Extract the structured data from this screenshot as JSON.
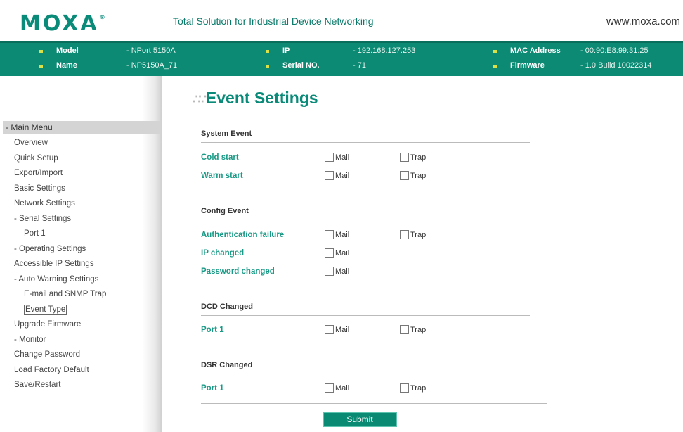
{
  "header": {
    "logo": "MOXA",
    "logo_mark": "®",
    "tagline": "Total Solution for Industrial Device Networking",
    "website": "www.moxa.com"
  },
  "info": {
    "model_label": "Model",
    "model_value": "- NPort 5150A",
    "name_label": "Name",
    "name_value": "- NP5150A_71",
    "ip_label": "IP",
    "ip_value": "- 192.168.127.253",
    "serial_label": "Serial NO.",
    "serial_value": "- 71",
    "mac_label": "MAC Address",
    "mac_value": "- 00:90:E8:99:31:25",
    "firmware_label": "Firmware",
    "firmware_value": "- 1.0 Build 10022314"
  },
  "sidebar": {
    "head": "- Main Menu",
    "items": [
      {
        "label": "Overview"
      },
      {
        "label": "Quick Setup"
      },
      {
        "label": "Export/Import"
      },
      {
        "label": "Basic Settings"
      },
      {
        "label": "Network Settings"
      },
      {
        "label": "- Serial Settings"
      },
      {
        "label": "Port 1"
      },
      {
        "label": "- Operating Settings"
      },
      {
        "label": "Accessible IP Settings"
      },
      {
        "label": "- Auto Warning Settings"
      },
      {
        "label": "E-mail and SNMP Trap"
      },
      {
        "label": "Event Type"
      },
      {
        "label": "Upgrade Firmware"
      },
      {
        "label": "- Monitor"
      },
      {
        "label": "Change Password"
      },
      {
        "label": "Load Factory Default"
      },
      {
        "label": "Save/Restart"
      }
    ]
  },
  "main": {
    "title": "Event Settings",
    "sections": {
      "system": "System Event",
      "config": "Config Event",
      "dcd": "DCD Changed",
      "dsr": "DSR Changed"
    },
    "rows": {
      "cold_start": "Cold start",
      "warm_start": "Warm start",
      "auth_failure": "Authentication failure",
      "ip_changed": "IP changed",
      "password_changed": "Password changed",
      "dcd_port1": "Port 1",
      "dsr_port1": "Port 1"
    },
    "mail_label": "Mail",
    "trap_label": "Trap",
    "submit_label": "Submit"
  },
  "colors": {
    "brand": "#0a8a78",
    "infobar": "#0c8a73",
    "label_green": "#1a9a86"
  }
}
